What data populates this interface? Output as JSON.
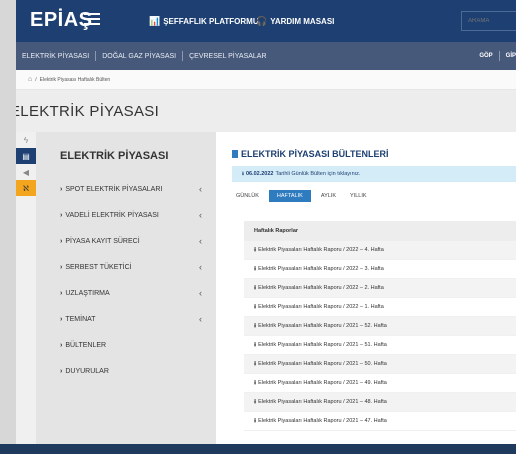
{
  "header": {
    "logo": "EPİAŞ",
    "links": [
      {
        "icon": "chart-icon",
        "glyph": "📊",
        "label": "ŞEFFAFLIK PLATFORMU"
      },
      {
        "icon": "headset-icon",
        "glyph": "🎧",
        "label": "YARDIM MASASI"
      }
    ],
    "search_placeholder": "ARAMA"
  },
  "nav": {
    "items": [
      "ELEKTRİK PİYASASI",
      "DOĞAL GAZ PİYASASI",
      "ÇEVRESEL PİYASALAR"
    ],
    "right": [
      "GÖP",
      "GİP"
    ]
  },
  "breadcrumb": {
    "home_glyph": "⌂",
    "separator": "/",
    "current": "Elektrik Piyasası Haftalık Bülten"
  },
  "page": {
    "title": "ELEKTRİK PİYASASI"
  },
  "rail": [
    {
      "icon": "lightning-icon",
      "glyph": "ϟ"
    },
    {
      "icon": "document-icon",
      "glyph": "▤"
    },
    {
      "icon": "megaphone-icon",
      "glyph": "◀"
    },
    {
      "icon": "rss-icon",
      "glyph": "ℵ"
    }
  ],
  "sidebar": {
    "title": "ELEKTRİK PİYASASI",
    "items": [
      {
        "label": "SPOT ELEKTRİK PİYASALARI",
        "arrow": "‹"
      },
      {
        "label": "VADELİ ELEKTRİK PİYASASI",
        "arrow": "‹"
      },
      {
        "label": "PİYASA KAYIT SÜRECİ",
        "arrow": "‹"
      },
      {
        "label": "SERBEST TÜKETİCİ",
        "arrow": "‹"
      },
      {
        "label": "UZLAŞTIRMA",
        "arrow": "‹"
      },
      {
        "label": "TEMİNAT",
        "arrow": "‹"
      },
      {
        "label": "BÜLTENLER",
        "arrow": ""
      },
      {
        "label": "DUYURULAR",
        "arrow": ""
      }
    ]
  },
  "main": {
    "title": "ELEKTRİK PİYASASI BÜLTENLERİ",
    "alert_date": "06.02.2022",
    "alert_text": "Tarihli Günlük Bülten için tıklayınız.",
    "tabs": [
      {
        "label": "GÜNLÜK",
        "active": false
      },
      {
        "label": "HAFTALIK",
        "active": true
      },
      {
        "label": "AYLIK",
        "active": false
      },
      {
        "label": "YILLIK",
        "active": false
      }
    ],
    "table_header": "Haftalık Raporlar",
    "rows": [
      "Elektrik Piyasaları Haftalık Raporu / 2022 – 4. Hafta",
      "Elektrik Piyasaları Haftalık Raporu / 2022 – 3. Hafta",
      "Elektrik Piyasaları Haftalık Raporu / 2022 – 2. Hafta",
      "Elektrik Piyasaları Haftalık Raporu / 2022 – 1. Hafta",
      "Elektrik Piyasaları Haftalık Raporu / 2021 – 52. Hafta",
      "Elektrik Piyasaları Haftalık Raporu / 2021 – 51. Hafta",
      "Elektrik Piyasaları Haftalık Raporu / 2021 – 50. Hafta",
      "Elektrik Piyasaları Haftalık Raporu / 2021 – 49. Hafta",
      "Elektrik Piyasaları Haftalık Raporu / 2021 – 48. Hafta",
      "Elektrik Piyasaları Haftalık Raporu / 2021 – 47. Hafta"
    ]
  }
}
